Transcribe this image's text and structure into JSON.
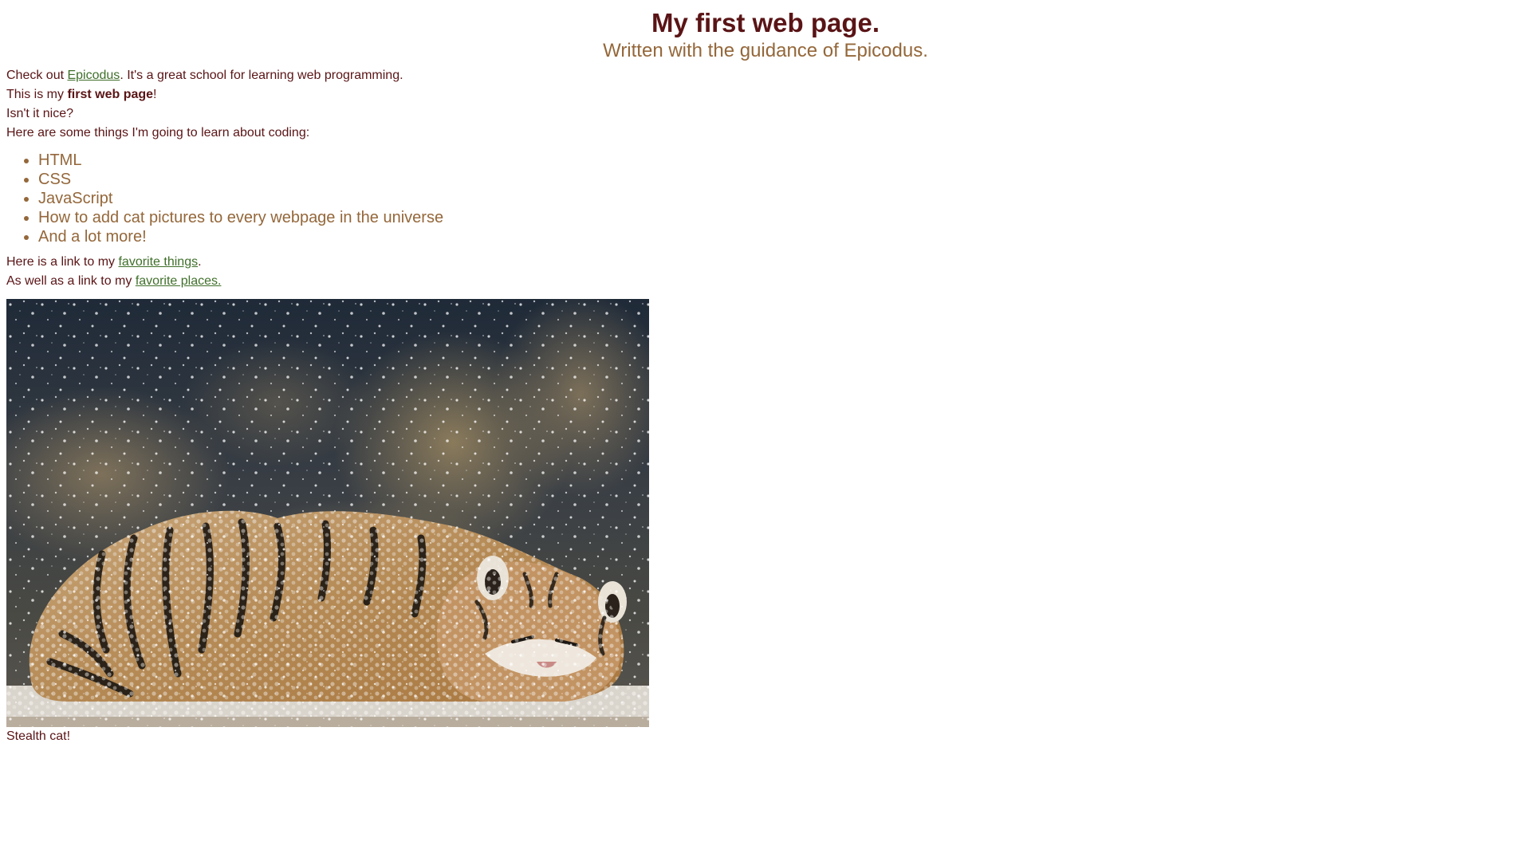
{
  "header": {
    "title": "My first web page.",
    "subtitle": "Written with the guidance of Epicodus."
  },
  "intro": {
    "prefix": "Check out ",
    "link_text": "Epicodus",
    "suffix": ". It's a great school for learning web programming."
  },
  "line2": {
    "prefix": "This is my ",
    "bold": "first web page",
    "suffix": "!"
  },
  "line3": "Isn't it nice?",
  "line4": "Here are some things I'm going to learn about coding:",
  "learn_list": [
    "HTML",
    "CSS",
    "JavaScript",
    "How to add cat pictures to every webpage in the universe",
    "And a lot more!"
  ],
  "favorite_things": {
    "prefix": "Here is a link to my ",
    "link_text": "favorite things",
    "suffix": "."
  },
  "favorite_places": {
    "prefix": "As well as a link to my ",
    "link_text": "favorite places."
  },
  "caption": "Stealth cat!",
  "colors": {
    "heading": "#5a1416",
    "subheading": "#94673a",
    "link": "#3f6f2a",
    "text": "#5a1416"
  }
}
